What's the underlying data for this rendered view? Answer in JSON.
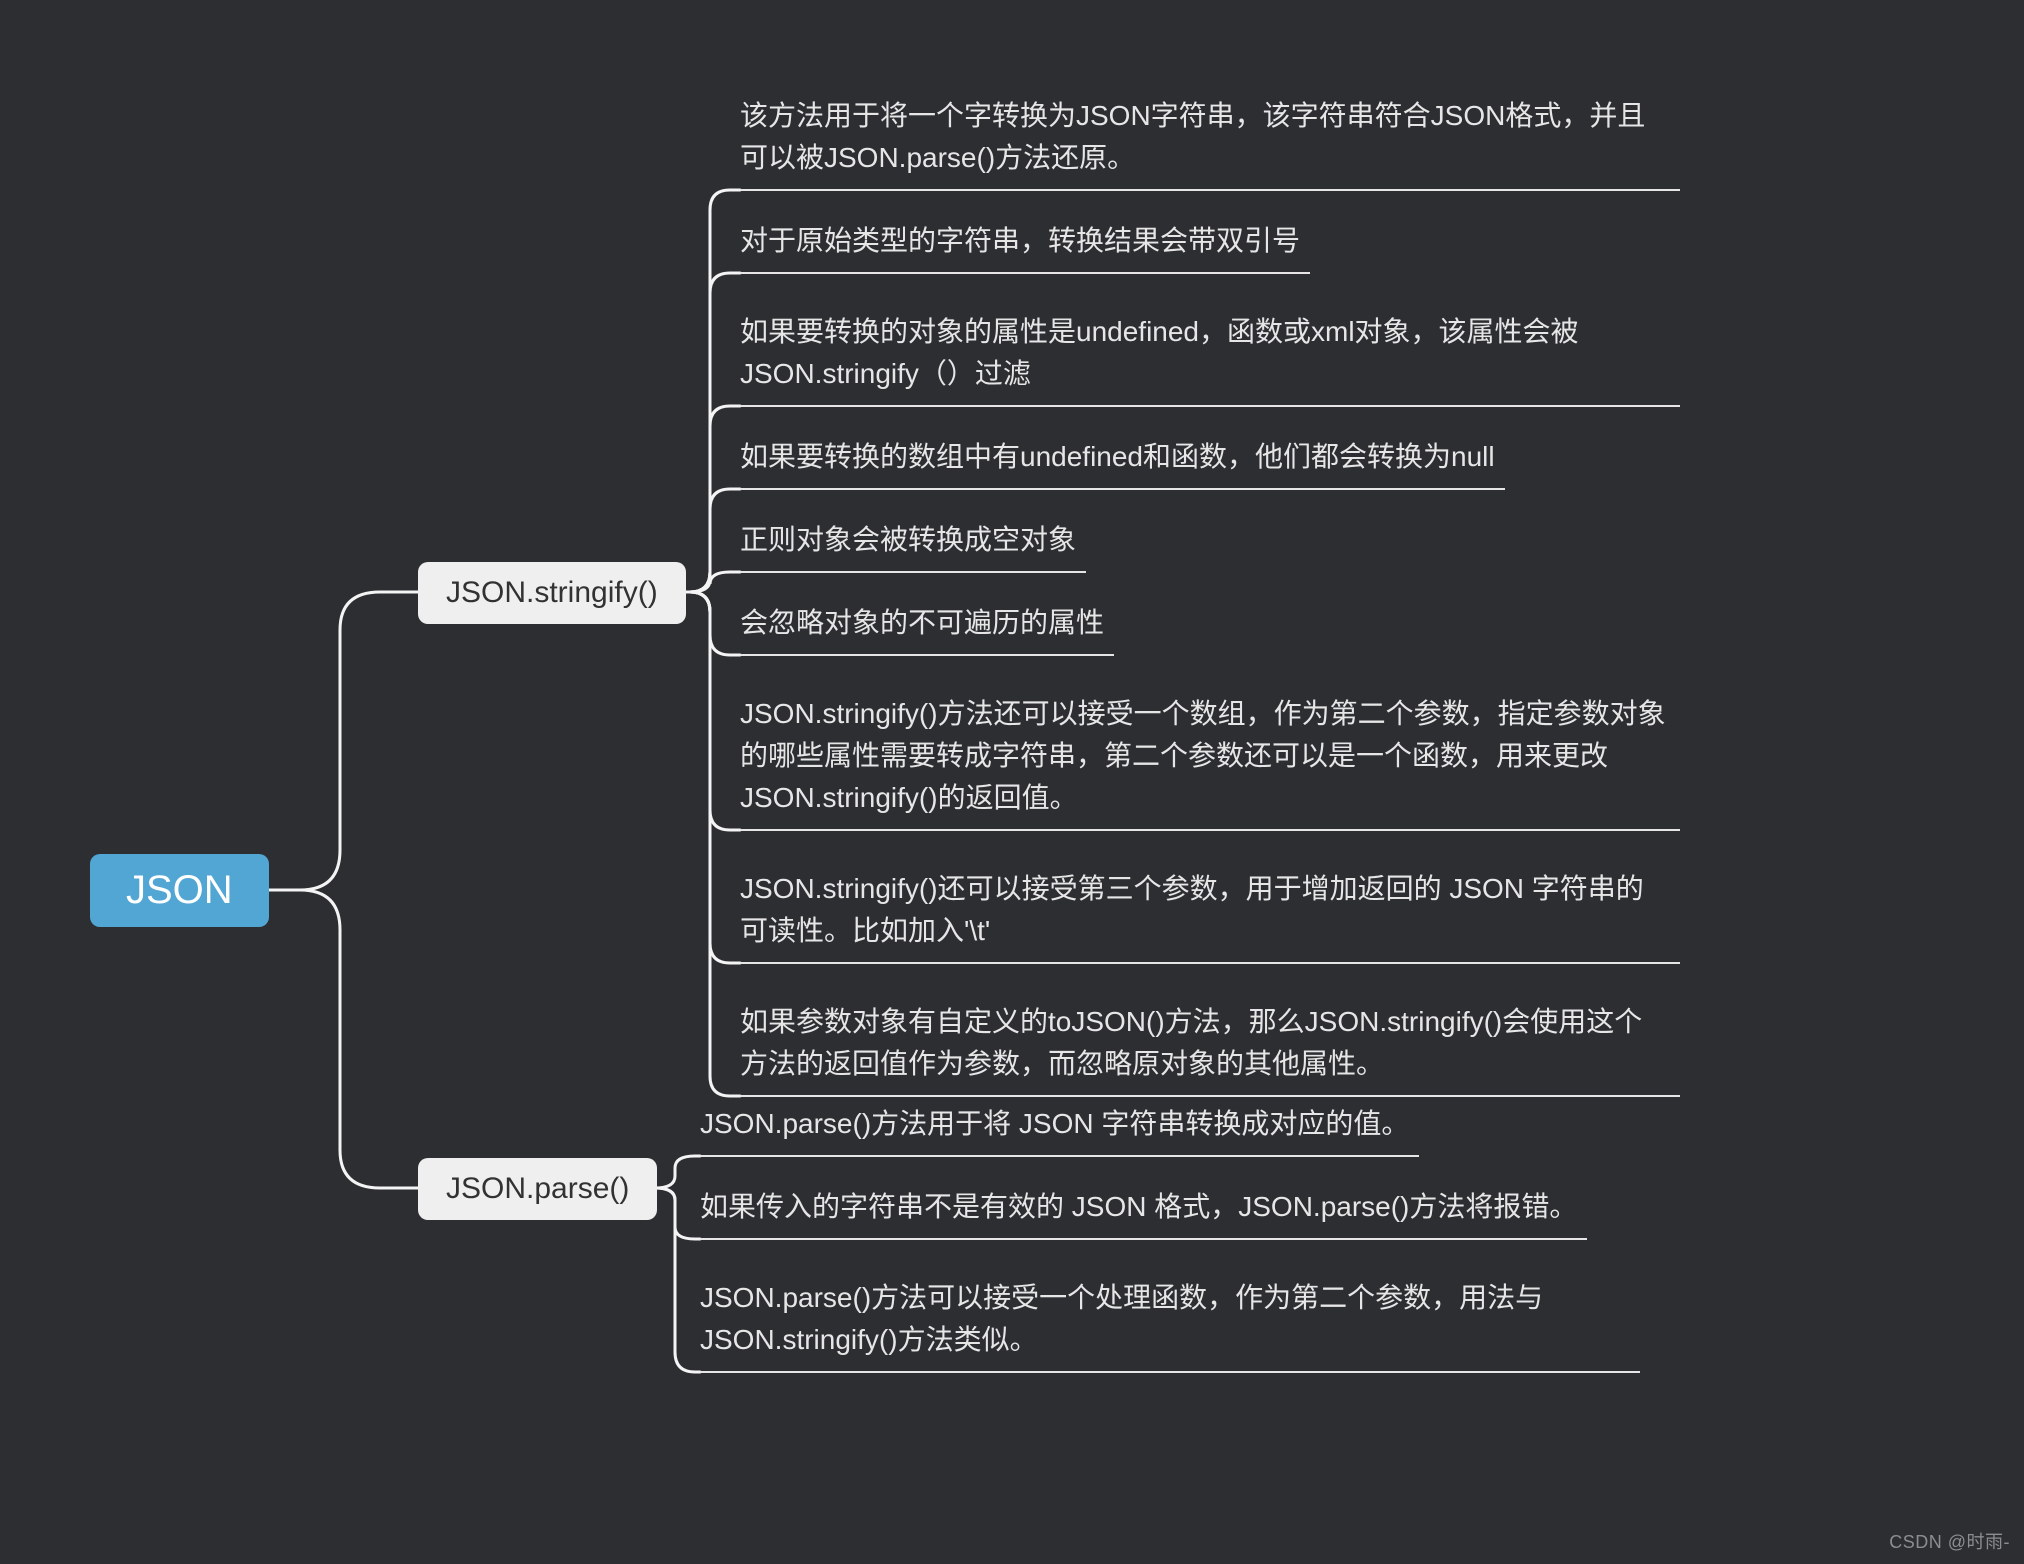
{
  "root": {
    "label": "JSON"
  },
  "methods": {
    "stringify": {
      "label": "JSON.stringify()"
    },
    "parse": {
      "label": "JSON.parse()"
    }
  },
  "stringify_leaves": [
    "该方法用于将一个字转换为JSON字符串，该字符串符合JSON格式，并且可以被JSON.parse()方法还原。",
    "对于原始类型的字符串，转换结果会带双引号",
    "如果要转换的对象的属性是undefined，函数或xml对象，该属性会被JSON.stringify（）过滤",
    "如果要转换的数组中有undefined和函数，他们都会转换为null",
    "正则对象会被转换成空对象",
    "会忽略对象的不可遍历的属性",
    "JSON.stringify()方法还可以接受一个数组，作为第二个参数，指定参数对象的哪些属性需要转成字符串，第二个参数还可以是一个函数，用来更改JSON.stringify()的返回值。",
    "JSON.stringify()还可以接受第三个参数，用于增加返回的 JSON 字符串的可读性。比如加入'\\t'",
    "如果参数对象有自定义的toJSON()方法，那么JSON.stringify()会使用这个方法的返回值作为参数，而忽略原对象的其他属性。"
  ],
  "parse_leaves": [
    "JSON.parse()方法用于将 JSON 字符串转换成对应的值。",
    "如果传入的字符串不是有效的 JSON 格式，JSON.parse()方法将报错。",
    "JSON.parse()方法可以接受一个处理函数，作为第二个参数，用法与JSON.stringify()方法类似。"
  ],
  "watermark": "CSDN @时雨-"
}
